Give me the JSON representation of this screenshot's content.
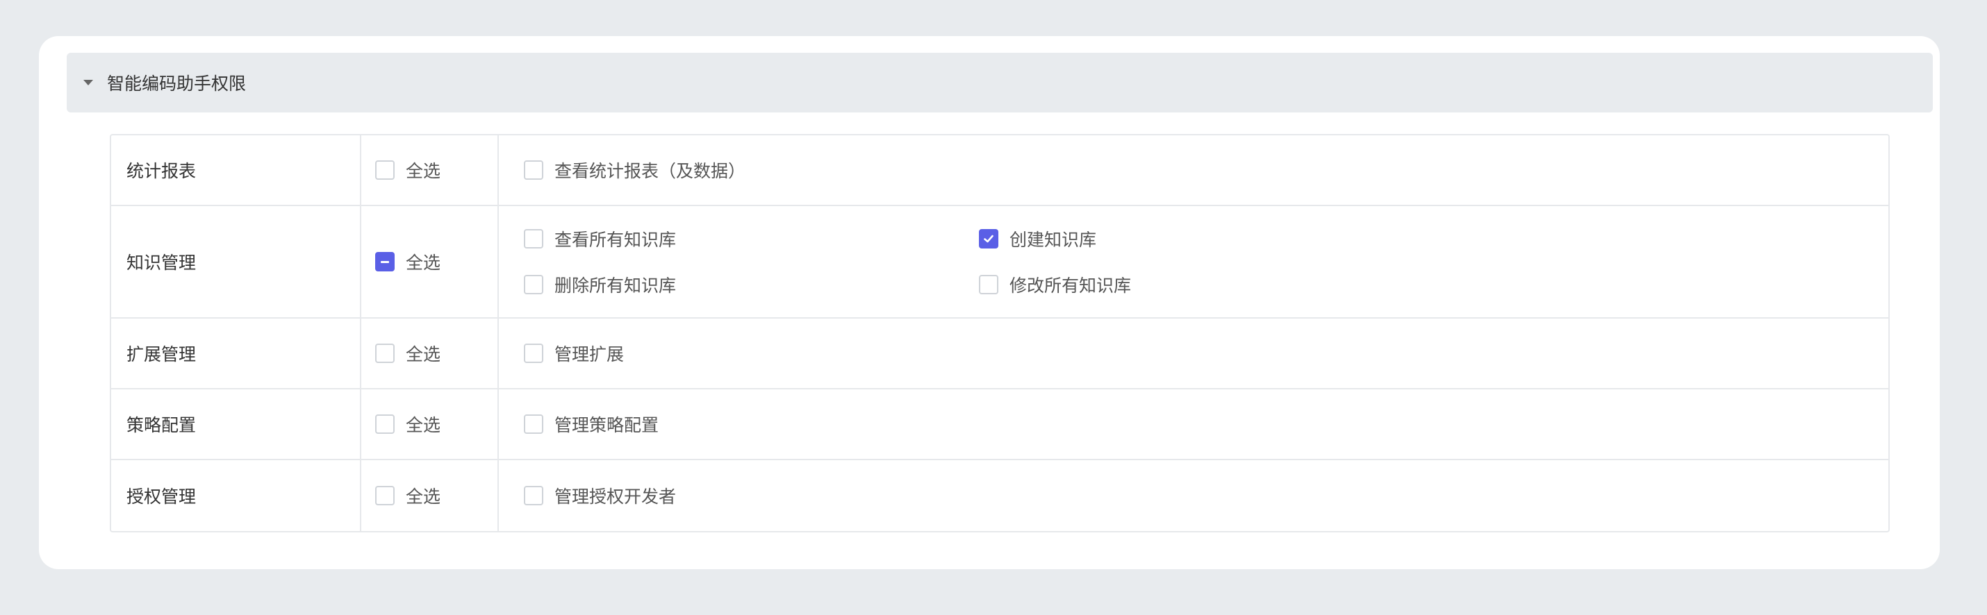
{
  "section": {
    "title": "智能编码助手权限",
    "expanded": true
  },
  "colors": {
    "accent": "#5a5fe6",
    "page_bg": "#e8ebee",
    "card_bg": "#ffffff",
    "border": "#e6e8eb"
  },
  "rows": [
    {
      "name": "统计报表",
      "select_all": {
        "label": "全选",
        "state": "unchecked"
      },
      "permissions": [
        {
          "label": "查看统计报表（及数据）",
          "checked": false
        }
      ]
    },
    {
      "name": "知识管理",
      "select_all": {
        "label": "全选",
        "state": "indeterminate"
      },
      "permissions": [
        {
          "label": "查看所有知识库",
          "checked": false
        },
        {
          "label": "创建知识库",
          "checked": true
        },
        {
          "label": "删除所有知识库",
          "checked": false
        },
        {
          "label": "修改所有知识库",
          "checked": false
        }
      ]
    },
    {
      "name": "扩展管理",
      "select_all": {
        "label": "全选",
        "state": "unchecked"
      },
      "permissions": [
        {
          "label": "管理扩展",
          "checked": false
        }
      ]
    },
    {
      "name": "策略配置",
      "select_all": {
        "label": "全选",
        "state": "unchecked"
      },
      "permissions": [
        {
          "label": "管理策略配置",
          "checked": false
        }
      ]
    },
    {
      "name": "授权管理",
      "select_all": {
        "label": "全选",
        "state": "unchecked"
      },
      "permissions": [
        {
          "label": "管理授权开发者",
          "checked": false
        }
      ]
    }
  ]
}
